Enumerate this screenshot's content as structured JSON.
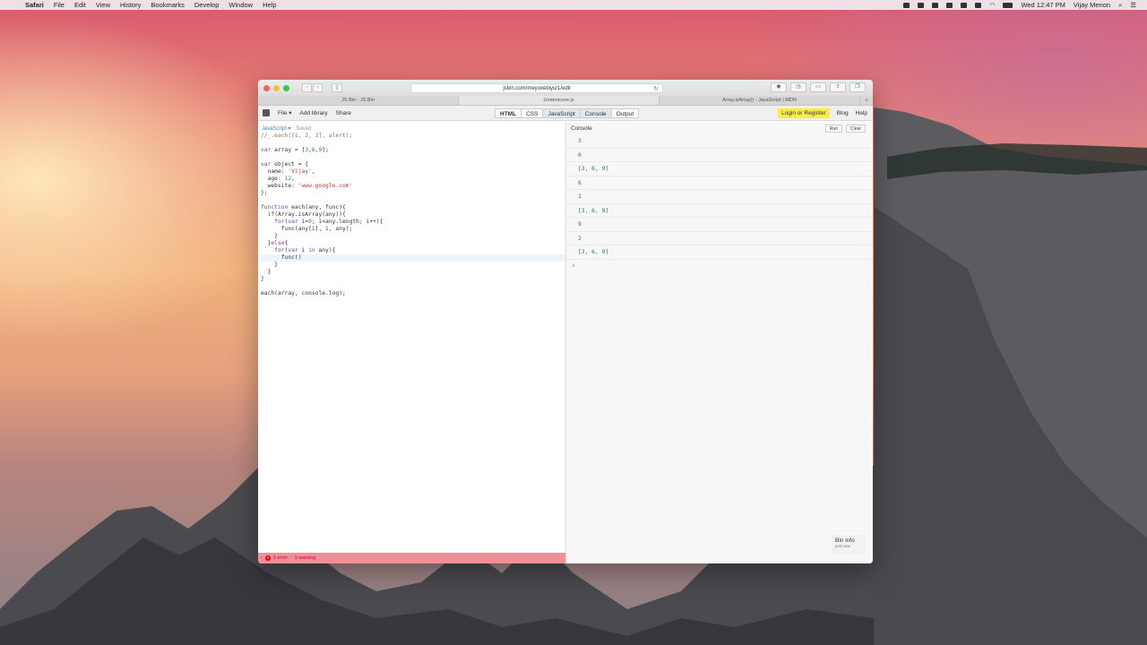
{
  "menubar": {
    "app": "Safari",
    "items": [
      "File",
      "Edit",
      "View",
      "History",
      "Bookmarks",
      "Develop",
      "Window",
      "Help"
    ],
    "clock": "Wed 12:47 PM",
    "user": "Vijay Menon"
  },
  "browser": {
    "url": "jsbin.com/meyoxebiyu/1/edit",
    "tabs": [
      "JS Bin - JS Bin",
      "Underscore.js",
      "Array.isArray() - JavaScript | MDN"
    ],
    "new_tab": "+"
  },
  "jsbin": {
    "menus": [
      "File ▾",
      "Add library",
      "Share"
    ],
    "panels": [
      "HTML",
      "CSS",
      "JavaScript",
      "Console",
      "Output"
    ],
    "login": "Login or Register",
    "blog": "Blog",
    "help": "Help"
  },
  "editor": {
    "language": "JavaScript ▾",
    "status": "Saved",
    "errors": "1 error",
    "warnings": "1 warning"
  },
  "console": {
    "title": "Console",
    "run": "Run",
    "clear": "Clear",
    "lines": [
      "3",
      "0",
      "[3, 6, 9]",
      "6",
      "1",
      "[3, 6, 9]",
      "9",
      "2",
      "[3, 6, 9]"
    ]
  },
  "bin_info": {
    "title": "Bin info",
    "subtitle": "just now"
  }
}
